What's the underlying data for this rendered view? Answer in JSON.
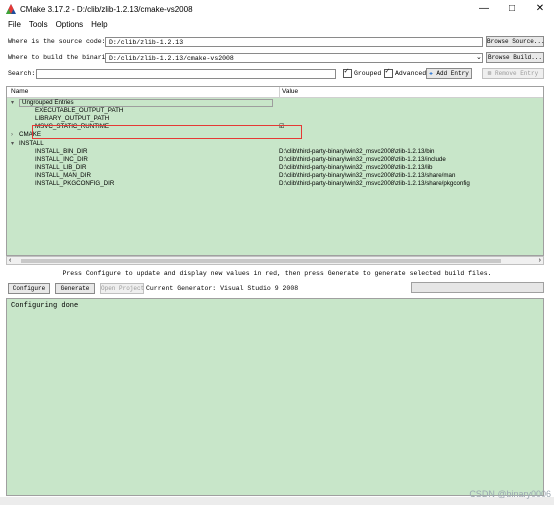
{
  "window": {
    "title": "CMake 3.17.2 - D:/clib/zlib-1.2.13/cmake-vs2008",
    "minimize": "—",
    "maximize": "□",
    "close": "✕"
  },
  "menu": {
    "file": "File",
    "tools": "Tools",
    "options": "Options",
    "help": "Help"
  },
  "source": {
    "label": "Where is the source code:",
    "value": "D:/clib/zlib-1.2.13",
    "browse_label": "Browse Source..."
  },
  "build": {
    "label": "Where to build the binaries:",
    "value": "D:/clib/zlib-1.2.13/cmake-vs2008",
    "browse_label": "Browse Build..."
  },
  "search": {
    "label": "Search:",
    "value": "",
    "grouped_label": "Grouped",
    "grouped_checked": true,
    "advanced_label": "Advanced",
    "advanced_checked": true,
    "add_entry_label": "Add Entry",
    "remove_entry_label": "Remove Entry"
  },
  "table": {
    "col_name": "Name",
    "col_value": "Value",
    "rows": [
      {
        "name": "Ungrouped Entries",
        "value": "",
        "level": 0,
        "toggle": "▾"
      },
      {
        "name": "EXECUTABLE_OUTPUT_PATH",
        "value": "",
        "level": 1,
        "toggle": ""
      },
      {
        "name": "LIBRARY_OUTPUT_PATH",
        "value": "",
        "level": 1,
        "toggle": ""
      },
      {
        "name": "MSVC_STATIC_RUNTIME",
        "value": "☑",
        "level": 1,
        "toggle": ""
      },
      {
        "name": "CMAKE",
        "value": "",
        "level": 0,
        "toggle": "›"
      },
      {
        "name": "INSTALL",
        "value": "",
        "level": 0,
        "toggle": "▾"
      },
      {
        "name": "INSTALL_BIN_DIR",
        "value": "D:\\clib\\third-party-binary\\win32_msvc2008\\zlib-1.2.13/bin",
        "level": 1,
        "toggle": ""
      },
      {
        "name": "INSTALL_INC_DIR",
        "value": "D:\\clib\\third-party-binary\\win32_msvc2008\\zlib-1.2.13/include",
        "level": 1,
        "toggle": ""
      },
      {
        "name": "INSTALL_LIB_DIR",
        "value": "D:\\clib\\third-party-binary\\win32_msvc2008\\zlib-1.2.13/lib",
        "level": 1,
        "toggle": ""
      },
      {
        "name": "INSTALL_MAN_DIR",
        "value": "D:\\clib\\third-party-binary\\win32_msvc2008\\zlib-1.2.13/share/man",
        "level": 1,
        "toggle": ""
      },
      {
        "name": "INSTALL_PKGCONFIG_DIR",
        "value": "D:\\clib\\third-party-binary\\win32_msvc2008\\zlib-1.2.13/share/pkgconfig",
        "level": 1,
        "toggle": ""
      }
    ]
  },
  "status_text": "Press Configure to update and display new values in red, then press Generate to generate selected build files.",
  "actions": {
    "configure_label": "Configure",
    "generate_label": "Generate",
    "open_project_label": "Open Project",
    "current_generator": "Current Generator: Visual Studio 9 2008"
  },
  "output": {
    "text": "Configuring done"
  },
  "watermark": "CSDN @binary0006",
  "colors": {
    "tree_bg": "#c8e6c9",
    "highlight": "#e53935"
  }
}
